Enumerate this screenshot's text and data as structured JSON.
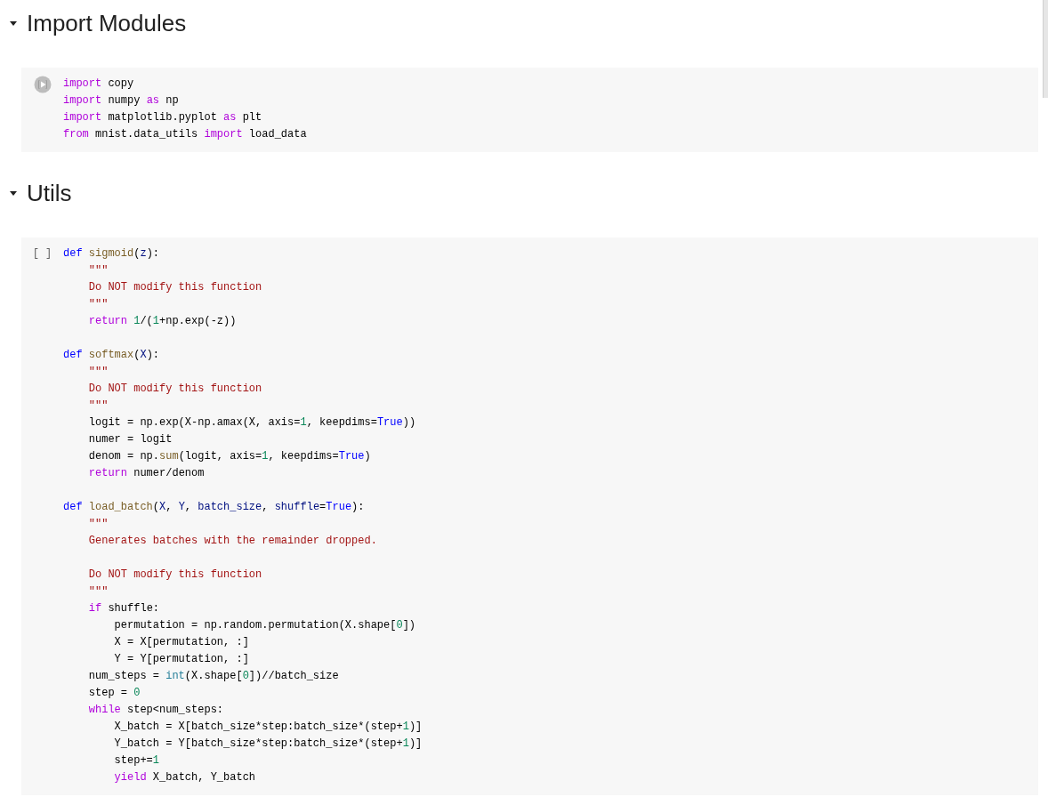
{
  "sections": [
    {
      "title": "Import Modules",
      "expanded": true,
      "cell": {
        "prompt": {
          "kind": "run-button"
        },
        "lines": [
          {
            "kind": "code",
            "tokens": [
              {
                "kind": "keyword",
                "text": "import"
              },
              {
                "kind": "plain",
                "text": " copy"
              }
            ]
          },
          {
            "kind": "code",
            "tokens": [
              {
                "kind": "keyword",
                "text": "import"
              },
              {
                "kind": "plain",
                "text": " numpy "
              },
              {
                "kind": "keyword",
                "text": "as"
              },
              {
                "kind": "plain",
                "text": " np"
              }
            ]
          },
          {
            "kind": "code",
            "tokens": [
              {
                "kind": "keyword",
                "text": "import"
              },
              {
                "kind": "plain",
                "text": " matplotlib.pyplot "
              },
              {
                "kind": "keyword",
                "text": "as"
              },
              {
                "kind": "plain",
                "text": " plt"
              }
            ]
          },
          {
            "kind": "code",
            "tokens": [
              {
                "kind": "keyword",
                "text": "from"
              },
              {
                "kind": "plain",
                "text": " mnist.data_utils "
              },
              {
                "kind": "keyword",
                "text": "import"
              },
              {
                "kind": "plain",
                "text": " load_data"
              }
            ]
          }
        ]
      }
    },
    {
      "title": "Utils",
      "expanded": true,
      "cell": {
        "prompt": {
          "kind": "execution-count",
          "text": "[ ]"
        },
        "lines": [
          {
            "kind": "code",
            "tokens": [
              {
                "kind": "def",
                "text": "def"
              },
              {
                "kind": "function",
                "text": " sigmoid"
              },
              {
                "kind": "plain",
                "text": "("
              },
              {
                "kind": "param",
                "text": "z"
              },
              {
                "kind": "plain",
                "text": "):"
              }
            ]
          },
          {
            "kind": "code",
            "tokens": [
              {
                "kind": "string",
                "text": "    \"\"\""
              }
            ]
          },
          {
            "kind": "code",
            "tokens": [
              {
                "kind": "string",
                "text": "    Do NOT modify this function"
              }
            ]
          },
          {
            "kind": "code",
            "tokens": [
              {
                "kind": "string",
                "text": "    \"\"\""
              }
            ]
          },
          {
            "kind": "code",
            "tokens": [
              {
                "kind": "keyword",
                "text": "    return"
              },
              {
                "kind": "number",
                "text": " 1"
              },
              {
                "kind": "plain",
                "text": "/("
              },
              {
                "kind": "number",
                "text": "1"
              },
              {
                "kind": "plain",
                "text": "+np.exp(-z))"
              }
            ]
          },
          {
            "kind": "blank"
          },
          {
            "kind": "code",
            "tokens": [
              {
                "kind": "def",
                "text": "def"
              },
              {
                "kind": "function",
                "text": " softmax"
              },
              {
                "kind": "plain",
                "text": "("
              },
              {
                "kind": "param",
                "text": "X"
              },
              {
                "kind": "plain",
                "text": "):"
              }
            ]
          },
          {
            "kind": "code",
            "tokens": [
              {
                "kind": "string",
                "text": "    \"\"\""
              }
            ]
          },
          {
            "kind": "code",
            "tokens": [
              {
                "kind": "string",
                "text": "    Do NOT modify this function"
              }
            ]
          },
          {
            "kind": "code",
            "tokens": [
              {
                "kind": "string",
                "text": "    \"\"\""
              }
            ]
          },
          {
            "kind": "code",
            "tokens": [
              {
                "kind": "plain",
                "text": "    logit = np.exp(X-np.amax(X, axis="
              },
              {
                "kind": "number",
                "text": "1"
              },
              {
                "kind": "plain",
                "text": ", keepdims="
              },
              {
                "kind": "constant",
                "text": "True"
              },
              {
                "kind": "plain",
                "text": "))"
              }
            ]
          },
          {
            "kind": "code",
            "tokens": [
              {
                "kind": "plain",
                "text": "    numer = logit"
              }
            ]
          },
          {
            "kind": "code",
            "tokens": [
              {
                "kind": "plain",
                "text": "    denom = np."
              },
              {
                "kind": "function",
                "text": "sum"
              },
              {
                "kind": "plain",
                "text": "(logit, axis="
              },
              {
                "kind": "number",
                "text": "1"
              },
              {
                "kind": "plain",
                "text": ", keepdims="
              },
              {
                "kind": "constant",
                "text": "True"
              },
              {
                "kind": "plain",
                "text": ")"
              }
            ]
          },
          {
            "kind": "code",
            "tokens": [
              {
                "kind": "keyword",
                "text": "    return"
              },
              {
                "kind": "plain",
                "text": " numer/denom"
              }
            ]
          },
          {
            "kind": "blank"
          },
          {
            "kind": "code",
            "tokens": [
              {
                "kind": "def",
                "text": "def"
              },
              {
                "kind": "function",
                "text": " load_batch"
              },
              {
                "kind": "plain",
                "text": "("
              },
              {
                "kind": "param",
                "text": "X"
              },
              {
                "kind": "plain",
                "text": ","
              },
              {
                "kind": "param",
                "text": " Y"
              },
              {
                "kind": "plain",
                "text": ","
              },
              {
                "kind": "param",
                "text": " batch_size"
              },
              {
                "kind": "plain",
                "text": ","
              },
              {
                "kind": "param",
                "text": " shuffle"
              },
              {
                "kind": "plain",
                "text": "="
              },
              {
                "kind": "constant",
                "text": "True"
              },
              {
                "kind": "plain",
                "text": "):"
              }
            ]
          },
          {
            "kind": "code",
            "tokens": [
              {
                "kind": "string",
                "text": "    \"\"\""
              }
            ]
          },
          {
            "kind": "code",
            "tokens": [
              {
                "kind": "string",
                "text": "    Generates batches with the remainder dropped."
              }
            ]
          },
          {
            "kind": "blank"
          },
          {
            "kind": "code",
            "tokens": [
              {
                "kind": "string",
                "text": "    Do NOT modify this function"
              }
            ]
          },
          {
            "kind": "code",
            "tokens": [
              {
                "kind": "string",
                "text": "    \"\"\""
              }
            ]
          },
          {
            "kind": "code",
            "tokens": [
              {
                "kind": "keyword",
                "text": "    if"
              },
              {
                "kind": "plain",
                "text": " shuffle:"
              }
            ]
          },
          {
            "kind": "code",
            "tokens": [
              {
                "kind": "plain",
                "text": "        permutation = np.random.permutation(X.shape["
              },
              {
                "kind": "number",
                "text": "0"
              },
              {
                "kind": "plain",
                "text": "])"
              }
            ]
          },
          {
            "kind": "code",
            "tokens": [
              {
                "kind": "plain",
                "text": "        X = X[permutation, :]"
              }
            ]
          },
          {
            "kind": "code",
            "tokens": [
              {
                "kind": "plain",
                "text": "        Y = Y[permutation, :]"
              }
            ]
          },
          {
            "kind": "code",
            "tokens": [
              {
                "kind": "plain",
                "text": "    num_steps = "
              },
              {
                "kind": "builtin",
                "text": "int"
              },
              {
                "kind": "plain",
                "text": "(X.shape["
              },
              {
                "kind": "number",
                "text": "0"
              },
              {
                "kind": "plain",
                "text": "])//batch_size"
              }
            ]
          },
          {
            "kind": "code",
            "tokens": [
              {
                "kind": "plain",
                "text": "    step = "
              },
              {
                "kind": "number",
                "text": "0"
              }
            ]
          },
          {
            "kind": "code",
            "tokens": [
              {
                "kind": "keyword",
                "text": "    while"
              },
              {
                "kind": "plain",
                "text": " step<num_steps:"
              }
            ]
          },
          {
            "kind": "code",
            "tokens": [
              {
                "kind": "plain",
                "text": "        X_batch = X[batch_size*step:batch_size*(step+"
              },
              {
                "kind": "number",
                "text": "1"
              },
              {
                "kind": "plain",
                "text": ")]"
              }
            ]
          },
          {
            "kind": "code",
            "tokens": [
              {
                "kind": "plain",
                "text": "        Y_batch = Y[batch_size*step:batch_size*(step+"
              },
              {
                "kind": "number",
                "text": "1"
              },
              {
                "kind": "plain",
                "text": ")]"
              }
            ]
          },
          {
            "kind": "code",
            "tokens": [
              {
                "kind": "plain",
                "text": "        step+="
              },
              {
                "kind": "number",
                "text": "1"
              }
            ]
          },
          {
            "kind": "code",
            "tokens": [
              {
                "kind": "keyword",
                "text": "        yield"
              },
              {
                "kind": "plain",
                "text": " X_batch, Y_batch"
              }
            ]
          }
        ]
      }
    }
  ]
}
